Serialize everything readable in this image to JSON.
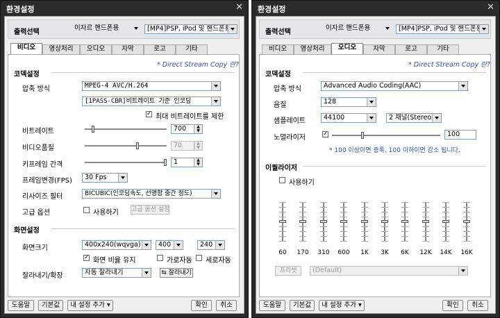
{
  "left": {
    "title": "환경설정",
    "output_label": "출력선택",
    "device": "이자르 핸드폰용",
    "format": "[MP4]PSP, iPod 및 핸드폰용",
    "tabs": [
      "비디오",
      "영상처리",
      "오디오",
      "자막",
      "로고",
      "기타"
    ],
    "active_tab": "비디오",
    "direct_stream": "* Direct Stream Copy 란?",
    "codec_section": "코덱설정",
    "compression_label": "압축 방식",
    "compression": "MPEG-4 AVC/H.264",
    "bitrate_mode": "[1PASS-CBR]비트레이트 기준 인코딩",
    "max_bitrate_label": "최대 비트레이트를 제한",
    "bitrate_label": "비트레이트",
    "bitrate": "700",
    "video_quality_label": "비디오품질",
    "video_quality": "70",
    "keyframe_label": "키프레임 간격",
    "keyframe": "1",
    "fps_label": "프레임변경(FPS)",
    "fps": "30 Fps",
    "resize_label": "리사이즈 필터",
    "resize": "BICUBIC(인코딩속도, 선명함 중간 정도)",
    "advanced_label": "고급 옵션",
    "use_label": "사용하기",
    "advanced_button": "고급 옵션 설정",
    "screen_section": "화면설정",
    "screen_size_label": "화면크기",
    "screen_size": "400x240(wqvga)",
    "width": "400",
    "height": "240",
    "keep_ratio_label": "화면 비율 유지",
    "h_auto_label": "가로자동",
    "v_auto_label": "세로자동",
    "crop_label": "잘라내기/확장",
    "crop": "자동 잘라내기",
    "crop_button": "잘라내기",
    "help": "도움말",
    "default": "기본값",
    "my_settings": "내 설정 추가",
    "ok": "확인",
    "cancel": "취소"
  },
  "right": {
    "title": "환경설정",
    "output_label": "출력선택",
    "device": "이자르 핸드폰용",
    "format": "[MP4]PSP, iPod 및 핸드폰용",
    "tabs": [
      "비디오",
      "영상처리",
      "오디오",
      "자막",
      "로고",
      "기타"
    ],
    "active_tab": "오디오",
    "direct_stream": "* Direct Stream Copy 란?",
    "codec_section": "코덱설정",
    "compression_label": "압축 방식",
    "compression": "Advanced Audio Coding(AAC)",
    "quality_label": "음질",
    "quality": "128",
    "sample_label": "샘플레이트",
    "sample": "44100",
    "channel": "2 채널(Stereo)",
    "normalizer_label": "노멀라이저",
    "normalizer": "100",
    "normalizer_note": "* 100 이상이면 증폭, 100 이하이면 감소 됩니다.",
    "eq_section": "이퀄라이저",
    "eq_use_label": "사용하기",
    "eq_bands": [
      "60",
      "170",
      "310",
      "600",
      "1K",
      "3K",
      "6K",
      "12K",
      "14K",
      "16K"
    ],
    "preset_button": "프리셋",
    "preset": "(Default)",
    "help": "도움말",
    "default": "기본값",
    "my_settings": "내 설정 추가",
    "ok": "확인",
    "cancel": "취소"
  },
  "colors": {
    "titlebar": "#2b2b2b",
    "panel": "#ffffff",
    "link": "#3050c0"
  }
}
